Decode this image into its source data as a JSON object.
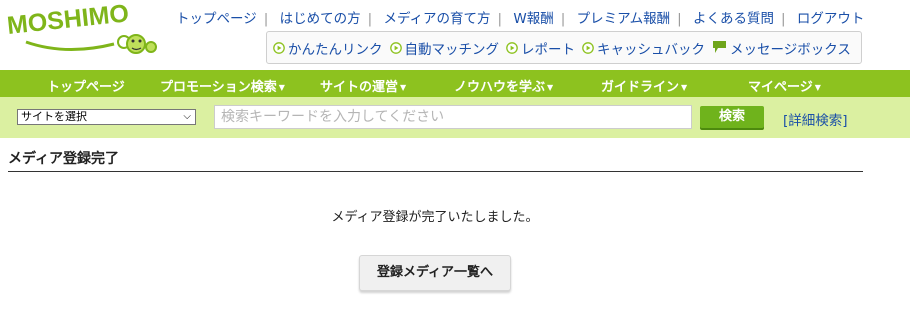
{
  "logo": {
    "text": "MOSHIMO"
  },
  "top_links": [
    "トップページ",
    "はじめての方",
    "メディアの育て方",
    "W報酬",
    "プレミアム報酬",
    "よくある質問",
    "ログアウト"
  ],
  "quick_links": [
    {
      "label": "かんたんリンク",
      "icon": "play-circle-icon"
    },
    {
      "label": "自動マッチング",
      "icon": "play-circle-icon"
    },
    {
      "label": "レポート",
      "icon": "play-circle-icon"
    },
    {
      "label": "キャッシュバック",
      "icon": "play-circle-icon"
    },
    {
      "label": "メッセージボックス",
      "icon": "message-icon"
    }
  ],
  "nav": [
    {
      "label": "トップページ",
      "caret": ""
    },
    {
      "label": "プロモーション検索",
      "caret": "▼"
    },
    {
      "label": "サイトの運営",
      "caret": "▼"
    },
    {
      "label": "ノウハウを学ぶ",
      "caret": "▼"
    },
    {
      "label": "ガイドライン",
      "caret": "▼"
    },
    {
      "label": "マイページ",
      "caret": "▼"
    }
  ],
  "search": {
    "site_select": "サイトを選択",
    "placeholder": "検索キーワードを入力してください",
    "button": "検索",
    "advanced": "[詳細検索]"
  },
  "page": {
    "title": "メディア登録完了",
    "message": "メディア登録が完了いたしました。",
    "list_button": "登録メディア一覧へ"
  },
  "colors": {
    "brand_green": "#8dc21f",
    "search_bg": "#dbf0a1",
    "link_blue": "#1a4fa8"
  }
}
